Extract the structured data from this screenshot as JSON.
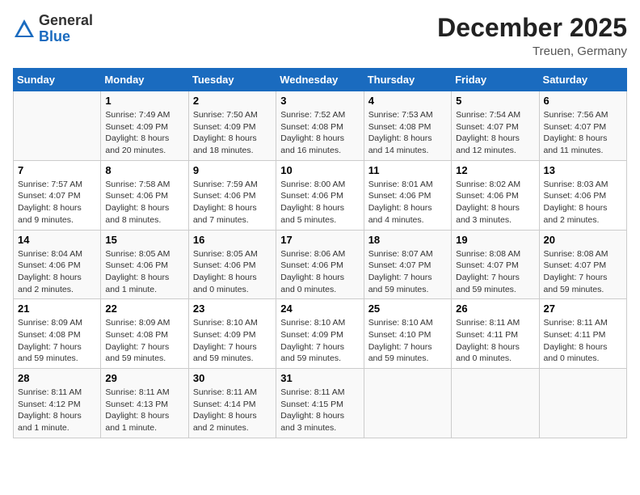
{
  "header": {
    "logo_general": "General",
    "logo_blue": "Blue",
    "month_title": "December 2025",
    "location": "Treuen, Germany"
  },
  "days_of_week": [
    "Sunday",
    "Monday",
    "Tuesday",
    "Wednesday",
    "Thursday",
    "Friday",
    "Saturday"
  ],
  "weeks": [
    [
      {
        "day": "",
        "info": ""
      },
      {
        "day": "1",
        "info": "Sunrise: 7:49 AM\nSunset: 4:09 PM\nDaylight: 8 hours\nand 20 minutes."
      },
      {
        "day": "2",
        "info": "Sunrise: 7:50 AM\nSunset: 4:09 PM\nDaylight: 8 hours\nand 18 minutes."
      },
      {
        "day": "3",
        "info": "Sunrise: 7:52 AM\nSunset: 4:08 PM\nDaylight: 8 hours\nand 16 minutes."
      },
      {
        "day": "4",
        "info": "Sunrise: 7:53 AM\nSunset: 4:08 PM\nDaylight: 8 hours\nand 14 minutes."
      },
      {
        "day": "5",
        "info": "Sunrise: 7:54 AM\nSunset: 4:07 PM\nDaylight: 8 hours\nand 12 minutes."
      },
      {
        "day": "6",
        "info": "Sunrise: 7:56 AM\nSunset: 4:07 PM\nDaylight: 8 hours\nand 11 minutes."
      }
    ],
    [
      {
        "day": "7",
        "info": "Sunrise: 7:57 AM\nSunset: 4:07 PM\nDaylight: 8 hours\nand 9 minutes."
      },
      {
        "day": "8",
        "info": "Sunrise: 7:58 AM\nSunset: 4:06 PM\nDaylight: 8 hours\nand 8 minutes."
      },
      {
        "day": "9",
        "info": "Sunrise: 7:59 AM\nSunset: 4:06 PM\nDaylight: 8 hours\nand 7 minutes."
      },
      {
        "day": "10",
        "info": "Sunrise: 8:00 AM\nSunset: 4:06 PM\nDaylight: 8 hours\nand 5 minutes."
      },
      {
        "day": "11",
        "info": "Sunrise: 8:01 AM\nSunset: 4:06 PM\nDaylight: 8 hours\nand 4 minutes."
      },
      {
        "day": "12",
        "info": "Sunrise: 8:02 AM\nSunset: 4:06 PM\nDaylight: 8 hours\nand 3 minutes."
      },
      {
        "day": "13",
        "info": "Sunrise: 8:03 AM\nSunset: 4:06 PM\nDaylight: 8 hours\nand 2 minutes."
      }
    ],
    [
      {
        "day": "14",
        "info": "Sunrise: 8:04 AM\nSunset: 4:06 PM\nDaylight: 8 hours\nand 2 minutes."
      },
      {
        "day": "15",
        "info": "Sunrise: 8:05 AM\nSunset: 4:06 PM\nDaylight: 8 hours\nand 1 minute."
      },
      {
        "day": "16",
        "info": "Sunrise: 8:05 AM\nSunset: 4:06 PM\nDaylight: 8 hours\nand 0 minutes."
      },
      {
        "day": "17",
        "info": "Sunrise: 8:06 AM\nSunset: 4:06 PM\nDaylight: 8 hours\nand 0 minutes."
      },
      {
        "day": "18",
        "info": "Sunrise: 8:07 AM\nSunset: 4:07 PM\nDaylight: 7 hours\nand 59 minutes."
      },
      {
        "day": "19",
        "info": "Sunrise: 8:08 AM\nSunset: 4:07 PM\nDaylight: 7 hours\nand 59 minutes."
      },
      {
        "day": "20",
        "info": "Sunrise: 8:08 AM\nSunset: 4:07 PM\nDaylight: 7 hours\nand 59 minutes."
      }
    ],
    [
      {
        "day": "21",
        "info": "Sunrise: 8:09 AM\nSunset: 4:08 PM\nDaylight: 7 hours\nand 59 minutes."
      },
      {
        "day": "22",
        "info": "Sunrise: 8:09 AM\nSunset: 4:08 PM\nDaylight: 7 hours\nand 59 minutes."
      },
      {
        "day": "23",
        "info": "Sunrise: 8:10 AM\nSunset: 4:09 PM\nDaylight: 7 hours\nand 59 minutes."
      },
      {
        "day": "24",
        "info": "Sunrise: 8:10 AM\nSunset: 4:09 PM\nDaylight: 7 hours\nand 59 minutes."
      },
      {
        "day": "25",
        "info": "Sunrise: 8:10 AM\nSunset: 4:10 PM\nDaylight: 7 hours\nand 59 minutes."
      },
      {
        "day": "26",
        "info": "Sunrise: 8:11 AM\nSunset: 4:11 PM\nDaylight: 8 hours\nand 0 minutes."
      },
      {
        "day": "27",
        "info": "Sunrise: 8:11 AM\nSunset: 4:11 PM\nDaylight: 8 hours\nand 0 minutes."
      }
    ],
    [
      {
        "day": "28",
        "info": "Sunrise: 8:11 AM\nSunset: 4:12 PM\nDaylight: 8 hours\nand 1 minute."
      },
      {
        "day": "29",
        "info": "Sunrise: 8:11 AM\nSunset: 4:13 PM\nDaylight: 8 hours\nand 1 minute."
      },
      {
        "day": "30",
        "info": "Sunrise: 8:11 AM\nSunset: 4:14 PM\nDaylight: 8 hours\nand 2 minutes."
      },
      {
        "day": "31",
        "info": "Sunrise: 8:11 AM\nSunset: 4:15 PM\nDaylight: 8 hours\nand 3 minutes."
      },
      {
        "day": "",
        "info": ""
      },
      {
        "day": "",
        "info": ""
      },
      {
        "day": "",
        "info": ""
      }
    ]
  ]
}
